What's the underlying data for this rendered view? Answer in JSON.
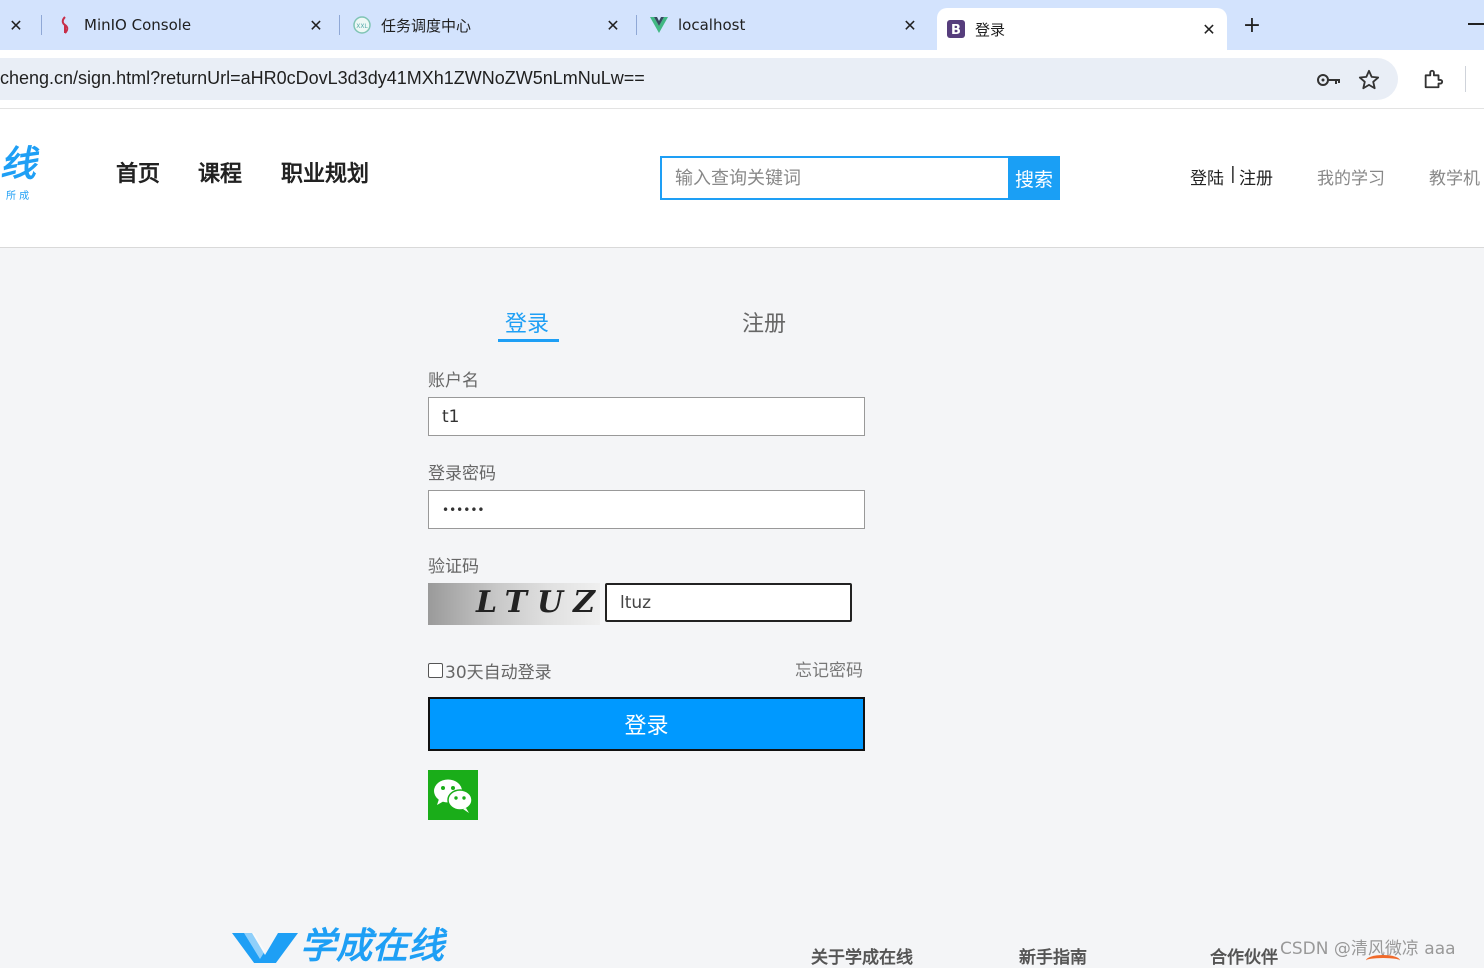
{
  "browser": {
    "tabs": [
      {
        "title": "",
        "favicon": "close-icon"
      },
      {
        "title": "MinIO Console",
        "favicon": "minio-icon"
      },
      {
        "title": "任务调度中心",
        "favicon": "xxl-job-icon"
      },
      {
        "title": "localhost",
        "favicon": "vue-icon"
      },
      {
        "title": "登录",
        "favicon": "bootstrap-icon",
        "active": true
      }
    ],
    "url": "cheng.cn/sign.html?returnUrl=aHR0cDovL3d3dy41MXh1ZWNoZW5nLmNuLw=="
  },
  "header": {
    "logo_text": "线",
    "logo_sub": "所 成",
    "nav": [
      "首页",
      "课程",
      "职业规划"
    ],
    "search": {
      "placeholder": "输入查询关键词",
      "button": "搜索"
    },
    "login_link": "登陆",
    "divider": "|",
    "register_link": "注册",
    "my_learning": "我的学习",
    "teaching": "教学机"
  },
  "form": {
    "tab_login": "登录",
    "tab_register": "注册",
    "account_label": "账户名",
    "account_value": "t1",
    "password_label": "登录密码",
    "password_value": "••••••",
    "captcha_label": "验证码",
    "captcha_image_text": "LTUZ",
    "captcha_value": "ltuz",
    "remember_label": "30天自动登录",
    "forgot_label": "忘记密码",
    "submit_label": "登录"
  },
  "footer": {
    "logo_text": "学成在线",
    "links": [
      "关于学成在线",
      "新手指南",
      "合作伙伴"
    ],
    "watermark": "CSDN @清风微凉 aaa"
  },
  "colors": {
    "accent": "#1e9ff5",
    "button": "#0099ff",
    "wechat": "#1aad19",
    "tabstrip": "#d3e3fd"
  }
}
